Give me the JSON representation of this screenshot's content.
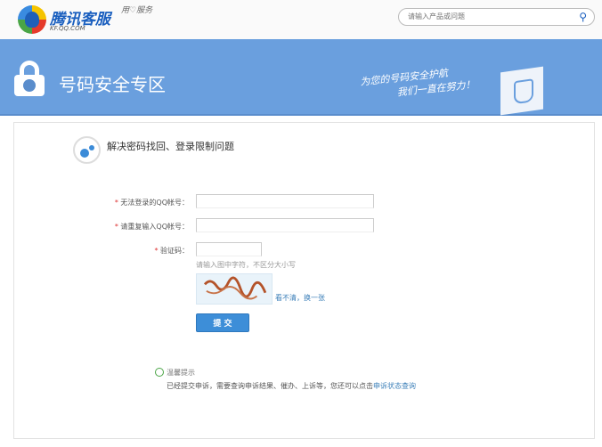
{
  "header": {
    "logo_title": "腾讯客服",
    "logo_sub": "KF.QQ.COM",
    "logo_slogan": "用♡服务",
    "search_placeholder": "请输入产品或问题"
  },
  "banner": {
    "title": "号码安全专区",
    "slogan_line1": "为您的号码安全护航",
    "slogan_line2": "我们一直在努力！"
  },
  "form": {
    "section_title": "解决密码找回、登录限制问题",
    "required_mark": "*",
    "label_account": "无法登录的QQ帐号：",
    "label_confirm": "请重复输入QQ帐号：",
    "label_captcha": "验证码：",
    "captcha_hint": "请输入图中字符，不区分大小写",
    "refresh_link": "看不清，换一张",
    "submit_label": "提 交"
  },
  "tip": {
    "title": "温馨提示",
    "text": "已经提交申诉，需要查询申诉结果、催办、上诉等，您还可以点击",
    "link": "申诉状态查询"
  },
  "colors": {
    "banner": "#6a9fde",
    "accent": "#3d8ed8",
    "link": "#3b7fb8"
  }
}
